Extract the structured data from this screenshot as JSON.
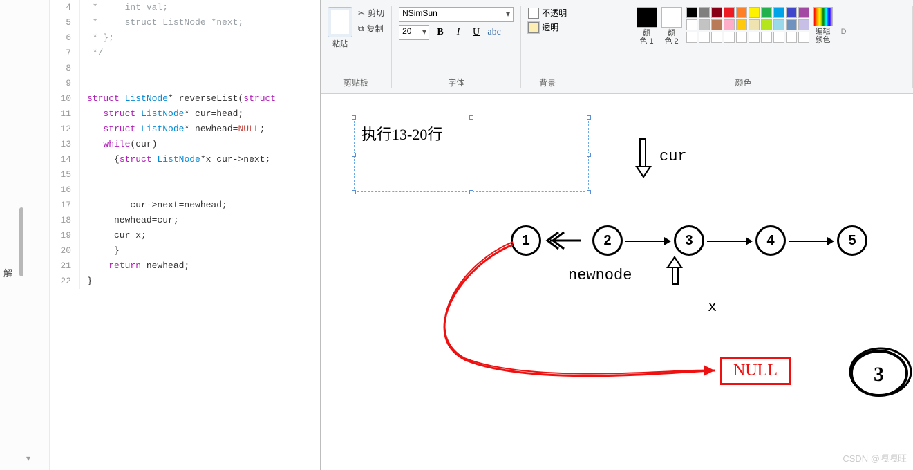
{
  "editor": {
    "sidebar_fragment": "解",
    "lines": [
      {
        "n": 4,
        "html": "<span class='c-comment'> *     int val;</span>"
      },
      {
        "n": 5,
        "html": "<span class='c-comment'> *     struct ListNode *next;</span>"
      },
      {
        "n": 6,
        "html": "<span class='c-comment'> * };</span>"
      },
      {
        "n": 7,
        "html": "<span class='c-comment'> */</span>"
      },
      {
        "n": 8,
        "html": ""
      },
      {
        "n": 9,
        "html": ""
      },
      {
        "n": 10,
        "html": "<span class='c-kw'>struct</span> <span class='c-type'>ListNode</span>* <span class='c-fn'>reverseList</span>(<span class='c-kw'>struct</span>"
      },
      {
        "n": 11,
        "html": "   <span class='c-kw'>struct</span> <span class='c-type'>ListNode</span>* cur=head;"
      },
      {
        "n": 12,
        "html": "   <span class='c-kw'>struct</span> <span class='c-type'>ListNode</span>* newhead=<span class='c-null'>NULL</span>;"
      },
      {
        "n": 13,
        "html": "   <span class='c-kw'>while</span>(cur)"
      },
      {
        "n": 14,
        "html": "     {<span class='c-kw'>struct</span> <span class='c-type'>ListNode</span>*x=cur-&gt;next;"
      },
      {
        "n": 15,
        "html": ""
      },
      {
        "n": 16,
        "html": ""
      },
      {
        "n": 17,
        "html": "        cur-&gt;next=newhead;"
      },
      {
        "n": 18,
        "html": "     newhead=cur;"
      },
      {
        "n": 19,
        "html": "     cur=x;"
      },
      {
        "n": 20,
        "html": "     }"
      },
      {
        "n": 21,
        "html": "    <span class='c-kw'>return</span> newhead;"
      },
      {
        "n": 22,
        "html": "}"
      }
    ]
  },
  "paint": {
    "groups": {
      "clipboard": {
        "label": "剪贴板",
        "paste": "粘贴",
        "cut": "剪切",
        "copy": "复制"
      },
      "font": {
        "label": "字体",
        "name": "NSimSun",
        "size": "20",
        "bold": "B",
        "italic": "I",
        "underline": "U",
        "strike": "abc"
      },
      "background": {
        "label": "背景",
        "opaque": "不透明",
        "transparent": "透明"
      },
      "colors": {
        "label": "颜色",
        "c1": "颜\n色 1",
        "c2": "颜\n色 2",
        "edit": "编辑\n颜色"
      },
      "tools_edge": {
        "label_d": "D"
      }
    },
    "palette_row1": [
      "#000000",
      "#7f7f7f",
      "#880015",
      "#ed1c24",
      "#ff7f27",
      "#fff200",
      "#22b14c",
      "#00a2e8",
      "#3f48cc",
      "#a349a4"
    ],
    "palette_row2": [
      "#ffffff",
      "#c3c3c3",
      "#b97a57",
      "#ffaec9",
      "#ffc90e",
      "#efe4b0",
      "#b5e61d",
      "#99d9ea",
      "#7092be",
      "#c8bfe7"
    ],
    "palette_row3": [
      "#ffffff",
      "#ffffff",
      "#ffffff",
      "#ffffff",
      "#ffffff",
      "#ffffff",
      "#ffffff",
      "#ffffff",
      "#ffffff",
      "#ffffff"
    ]
  },
  "canvas": {
    "textbox": "执行13-20行",
    "cur_label": "cur",
    "newnode_label": "newnode",
    "x_label": "x",
    "null_label": "NULL",
    "nodes": [
      "1",
      "2",
      "3",
      "4",
      "5"
    ],
    "scribble": "3",
    "watermark": "CSDN @嘎嘎旺"
  }
}
